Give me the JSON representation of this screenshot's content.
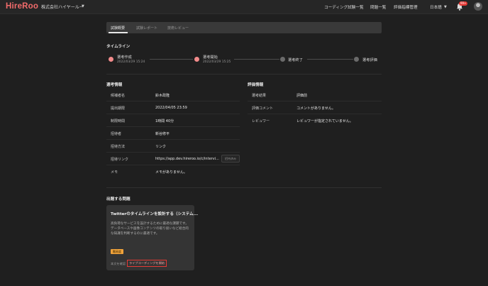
{
  "header": {
    "logo": "HireRoo",
    "company": "株式会社ハイヤールー",
    "nav": [
      "コーディング試験一覧",
      "問題一覧",
      "評価指標管理"
    ],
    "language": "日本語",
    "notification_count": "99+"
  },
  "tabs": [
    {
      "label": "試験概要",
      "active": true
    },
    {
      "label": "試験レポート",
      "active": false
    },
    {
      "label": "技術レビュー",
      "active": false
    }
  ],
  "timeline": {
    "title": "タイムライン",
    "steps": [
      {
        "label": "選考作成",
        "date": "2022/03/29 15:24",
        "status": "done"
      },
      {
        "label": "選考開始",
        "date": "2022/03/29 15:25",
        "status": "done"
      },
      {
        "label": "選考終了",
        "date": "",
        "status": "todo"
      },
      {
        "label": "選考評価",
        "date": "",
        "status": "todo"
      }
    ]
  },
  "selection_info": {
    "title": "選考情報",
    "rows": [
      {
        "key": "候補者名",
        "value": "鈴木政隆"
      },
      {
        "key": "提出期限",
        "value": "2022/04/05 23:59"
      },
      {
        "key": "制限時間",
        "value": "1時間 40分"
      },
      {
        "key": "招待者",
        "value": "新谷修平"
      },
      {
        "key": "招待方法",
        "value": "リンク"
      },
      {
        "key": "招待リンク",
        "value": "https://app.dev.hireroo.io/c/intervi..."
      },
      {
        "key": "メモ",
        "value": "メモがありません。"
      }
    ],
    "copy_button": "招待済み"
  },
  "evaluation_info": {
    "title": "評価情報",
    "rows": [
      {
        "key": "選考結果",
        "value": "評価前"
      },
      {
        "key": "評価コメント",
        "value": "コメントがありません。"
      },
      {
        "key": "レビュワー",
        "value": "レビュワーが指定されていません。"
      }
    ]
  },
  "problems": {
    "title": "出題する問題",
    "card": {
      "title": "Twitterのタイムラインを設計する（システム...",
      "description": "高負荷なサービスを設計するために最適な課題です。データベースや画像コンテンツの取り扱いなど総合的な知識を判断するのに最適です。",
      "badge": "難易度",
      "link": "本文を確認",
      "live_button": "ライブコーディングを開始"
    }
  },
  "colors": {
    "background": "#1f1f1f",
    "accent": "#f36b6b",
    "badge": "#f0a33b"
  }
}
